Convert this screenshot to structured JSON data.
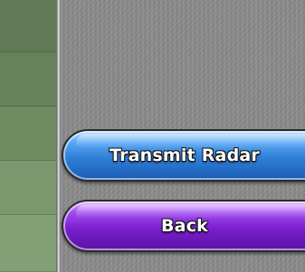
{
  "buttons": {
    "transmit_radar": "Transmit Radar",
    "back": "Back"
  },
  "colors": {
    "transmit_button": "#2f7fd9",
    "back_button": "#7b1fd0",
    "sidebar": "#6f8a62",
    "background": "#8c8c8c"
  }
}
